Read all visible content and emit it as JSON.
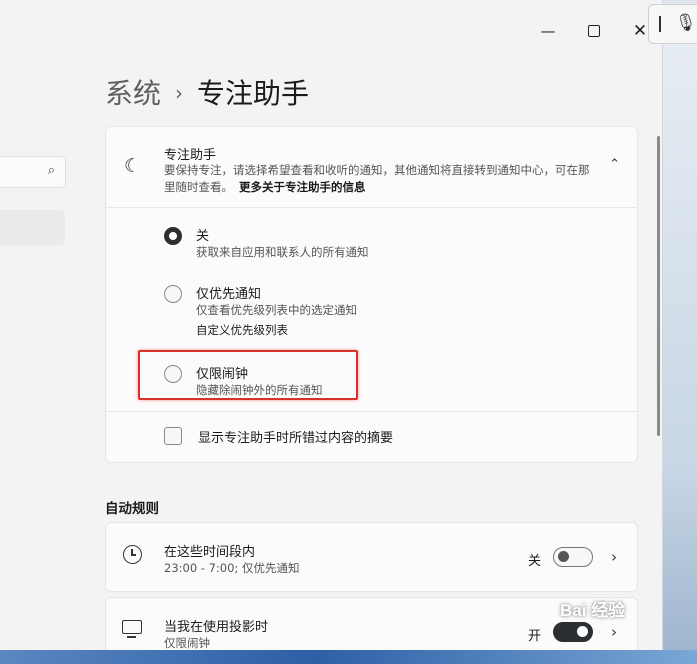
{
  "window": {
    "minimize_label": "—",
    "close_label": "✕"
  },
  "ime": {
    "grip": "|",
    "mic": "🎙"
  },
  "breadcrumb": {
    "parent": "系统",
    "separator": "›",
    "current": "专注助手"
  },
  "focus_assist": {
    "title": "专注助手",
    "description": "要保持专注，请选择希望查看和收听的通知，其他通知将直接转到通知中心，可在那里随时查看。",
    "more_link": "更多关于专注助手的信息",
    "expanded": true,
    "options": [
      {
        "label": "关",
        "sub": "获取来自应用和联系人的所有通知",
        "selected": true
      },
      {
        "label": "仅优先通知",
        "sub": "仅查看优先级列表中的选定通知",
        "link": "自定义优先级列表",
        "selected": false
      },
      {
        "label": "仅限闹钟",
        "sub": "隐藏除闹钟外的所有通知",
        "selected": false
      }
    ],
    "summary_checkbox": {
      "label": "显示专注助手时所错过内容的摘要",
      "checked": false
    }
  },
  "auto_rules": {
    "title": "自动规则",
    "items": [
      {
        "title": "在这些时间段内",
        "sub": "23:00 - 7:00; 仅优先通知",
        "state": "关",
        "on": false
      },
      {
        "title": "当我在使用投影时",
        "sub": "仅限闹钟",
        "state": "开",
        "on": true
      }
    ]
  },
  "watermark": {
    "text": "Bai 经验"
  },
  "icons": {
    "search": "search-icon",
    "moon": "moon-icon",
    "chevron_up": "chevron-up-icon",
    "clock": "clock-icon",
    "monitor": "monitor-icon",
    "chevron_right": "chevron-right-icon"
  },
  "colors": {
    "highlight": "#d9302a",
    "background": "#f3f3f3",
    "card": "#fbfbfb"
  }
}
